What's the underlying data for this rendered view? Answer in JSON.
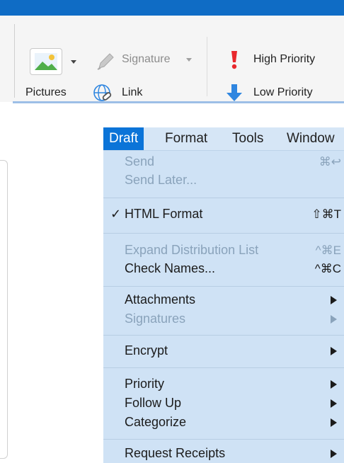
{
  "ribbon": {
    "pictures_label": "Pictures",
    "signature_label": "Signature",
    "link_label": "Link",
    "high_priority_label": "High Priority",
    "low_priority_label": "Low Priority"
  },
  "menubar": {
    "items": [
      "Draft",
      "Format",
      "Tools",
      "Window"
    ],
    "active": "Draft"
  },
  "menu": {
    "send": {
      "label": "Send",
      "shortcut": "⌘↩"
    },
    "send_later": {
      "label": "Send Later..."
    },
    "html_format": {
      "label": "HTML Format",
      "shortcut": "⇧⌘T",
      "checkmark": "✓"
    },
    "expand_distribution_list": {
      "label": "Expand Distribution List",
      "shortcut": "^⌘E"
    },
    "check_names": {
      "label": "Check Names...",
      "shortcut": "^⌘C"
    },
    "attachments": {
      "label": "Attachments"
    },
    "signatures": {
      "label": "Signatures"
    },
    "encrypt": {
      "label": "Encrypt"
    },
    "priority": {
      "label": "Priority"
    },
    "follow_up": {
      "label": "Follow Up"
    },
    "categorize": {
      "label": "Categorize"
    },
    "request_receipts": {
      "label": "Request Receipts"
    }
  },
  "colors": {
    "title_bar": "#0f6cc5",
    "menu_background": "#cfe2f5",
    "menu_highlight": "#0b74d8",
    "disabled_text": "#8aa3bb",
    "high_priority_icon": "#e8282d",
    "low_priority_icon": "#2f86e0"
  },
  "icons": [
    "picture-icon",
    "signature-pen-icon",
    "globe-link-icon",
    "exclamation-icon",
    "down-arrow-icon",
    "checkmark-icon",
    "submenu-arrow-icon"
  ]
}
